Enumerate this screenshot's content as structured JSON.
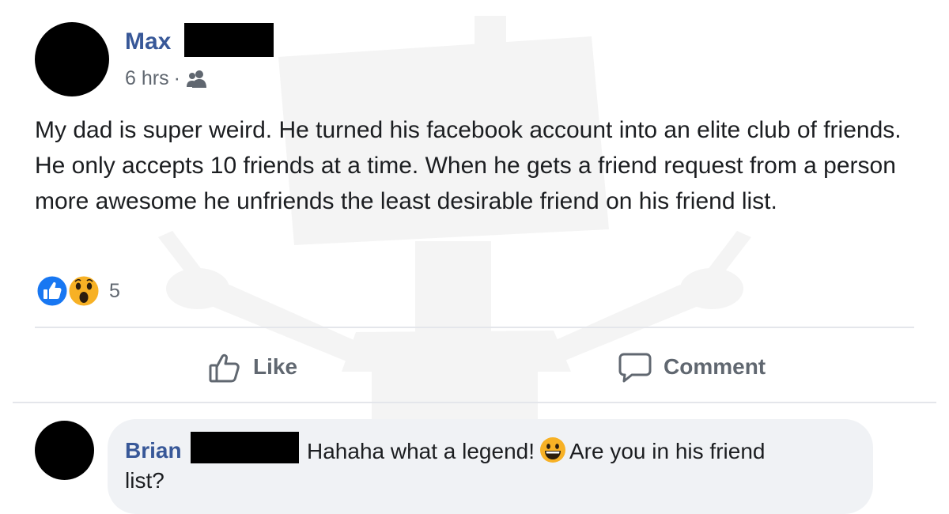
{
  "post": {
    "author_name": "Max",
    "timestamp": "6 hrs",
    "separator": "·",
    "audience_icon": "friends-icon",
    "text": "My dad is super weird. He turned his facebook account into an elite club of friends. He only accepts 10 friends at a time. When he gets a friend request from a person more awesome he unfriends the least desirable friend on his friend list.",
    "reactions": {
      "icons": [
        "like-reaction-icon",
        "wow-reaction-icon"
      ],
      "count": "5"
    }
  },
  "actions": {
    "like_label": "Like",
    "like_icon": "thumbs-up-icon",
    "comment_label": "Comment",
    "comment_icon": "speech-bubble-icon"
  },
  "comment": {
    "author_name": "Brian",
    "text_before_emoji": "Hahaha what a legend!",
    "emoji": "grinning-face-emoji",
    "text_after_emoji": "Are you in his friend",
    "text_line2": "list?"
  },
  "colors": {
    "author_link": "#385898",
    "secondary_text": "#606770",
    "like_blue": "#1877f2",
    "bubble_bg": "#f0f2f5"
  }
}
